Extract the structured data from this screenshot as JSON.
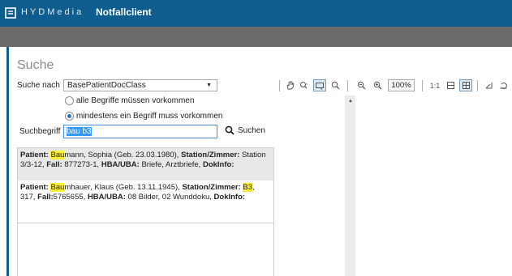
{
  "header": {
    "brand": "HYDMedia",
    "title": "Notfallclient",
    "icon": "document-logo-icon"
  },
  "colors": {
    "topbar": "#0f5c8e",
    "subbar": "#6b6b6b",
    "highlight": "#ffef2f",
    "selection": "#3399ff"
  },
  "search": {
    "page_title": "Suche",
    "search_in_label": "Suche nach",
    "search_in_value": "BasePatientDocClass",
    "option_all": "alle Begriffe müssen vorkommen",
    "option_any": "mindestens ein Begriff muss vorkommen",
    "selected_option": "any",
    "term_label": "Suchbegriff",
    "term_value": "bau b3",
    "button_label": "Suchen"
  },
  "results": [
    {
      "patient_label": "Patient:",
      "name_hl": "Bau",
      "name_rest": "mann, Sophia (Geb. 23.03.1980),",
      "station_label": "Station/Zimmer:",
      "station_pre": "Station 3/3-12,",
      "station_hl": "",
      "station_post": "",
      "fall_label": "Fall:",
      "fall_value": "877273-1,",
      "hba_label": "HBA/UBA:",
      "hba_value": "Briefe, Arztbriefe,",
      "dok_label": "DokInfo:"
    },
    {
      "patient_label": "Patient:",
      "name_hl": "Bau",
      "name_rest": "mhauer, Klaus (Geb. 13.11.1945),",
      "station_label": "Station/Zimmer:",
      "station_pre": "",
      "station_hl": "B3",
      "station_post": ", 317,",
      "fall_label": "Fall:",
      "fall_value": "5765655,",
      "hba_label": "HBA/UBA:",
      "hba_value": "08 Bilder, 02 Wunddoku,",
      "dok_label": "DokInfo:"
    }
  ],
  "viewer": {
    "zoom": "100%",
    "actual_size_label": "1:1",
    "tools": [
      "hand-icon",
      "zoom-area-icon",
      "select-rect-icon",
      "magnifier-icon",
      "zoom-out-icon",
      "zoom-in-icon",
      "fit-width-icon",
      "fit-page-icon",
      "rotate-left-icon",
      "rotate-right-icon"
    ]
  }
}
